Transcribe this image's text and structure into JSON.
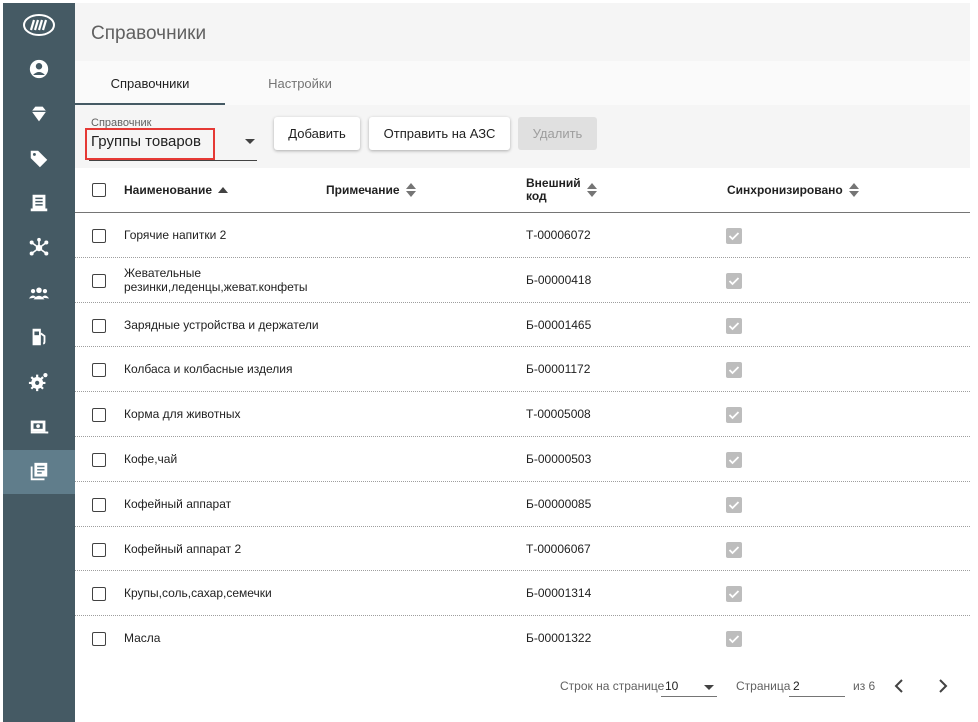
{
  "header": {
    "title": "Справочники"
  },
  "tabs": [
    {
      "label": "Справочники",
      "active": true
    },
    {
      "label": "Настройки",
      "active": false
    }
  ],
  "toolbar": {
    "selector_label": "Справочник",
    "selector_value": "Группы товаров",
    "add_label": "Добавить",
    "send_label": "Отправить на АЗС",
    "delete_label": "Удалить"
  },
  "columns": {
    "name": "Наименование",
    "note": "Примечание",
    "code_line1": "Внешний",
    "code_line2": "код",
    "sync": "Синхронизировано"
  },
  "rows": [
    {
      "name": "Горячие напитки 2",
      "code": "Т-00006072",
      "synced": true
    },
    {
      "name": "Жевательные резинки,леденцы,жеват.конфеты",
      "code": "Б-00000418",
      "synced": true
    },
    {
      "name": "Зарядные устройства и держатели",
      "code": "Б-00001465",
      "synced": true
    },
    {
      "name": "Колбаса и колбасные изделия",
      "code": "Б-00001172",
      "synced": true
    },
    {
      "name": "Корма для животных",
      "code": "Т-00005008",
      "synced": true
    },
    {
      "name": "Кофе,чай",
      "code": "Б-00000503",
      "synced": true
    },
    {
      "name": "Кофейный аппарат",
      "code": "Б-00000085",
      "synced": true
    },
    {
      "name": "Кофейный аппарат 2",
      "code": "Т-00006067",
      "synced": true
    },
    {
      "name": "Крупы,соль,сахар,семечки",
      "code": "Б-00001314",
      "synced": true
    },
    {
      "name": "Масла",
      "code": "Б-00001322",
      "synced": true
    }
  ],
  "footer": {
    "rows_per_page_label": "Строк на странице",
    "rows_per_page": "10",
    "page_label": "Страница",
    "page": "2",
    "of_label": "из 6"
  },
  "colors": {
    "sidebar": "#455a64",
    "sidebar_active": "#607d8b",
    "highlight": "#e53935"
  }
}
